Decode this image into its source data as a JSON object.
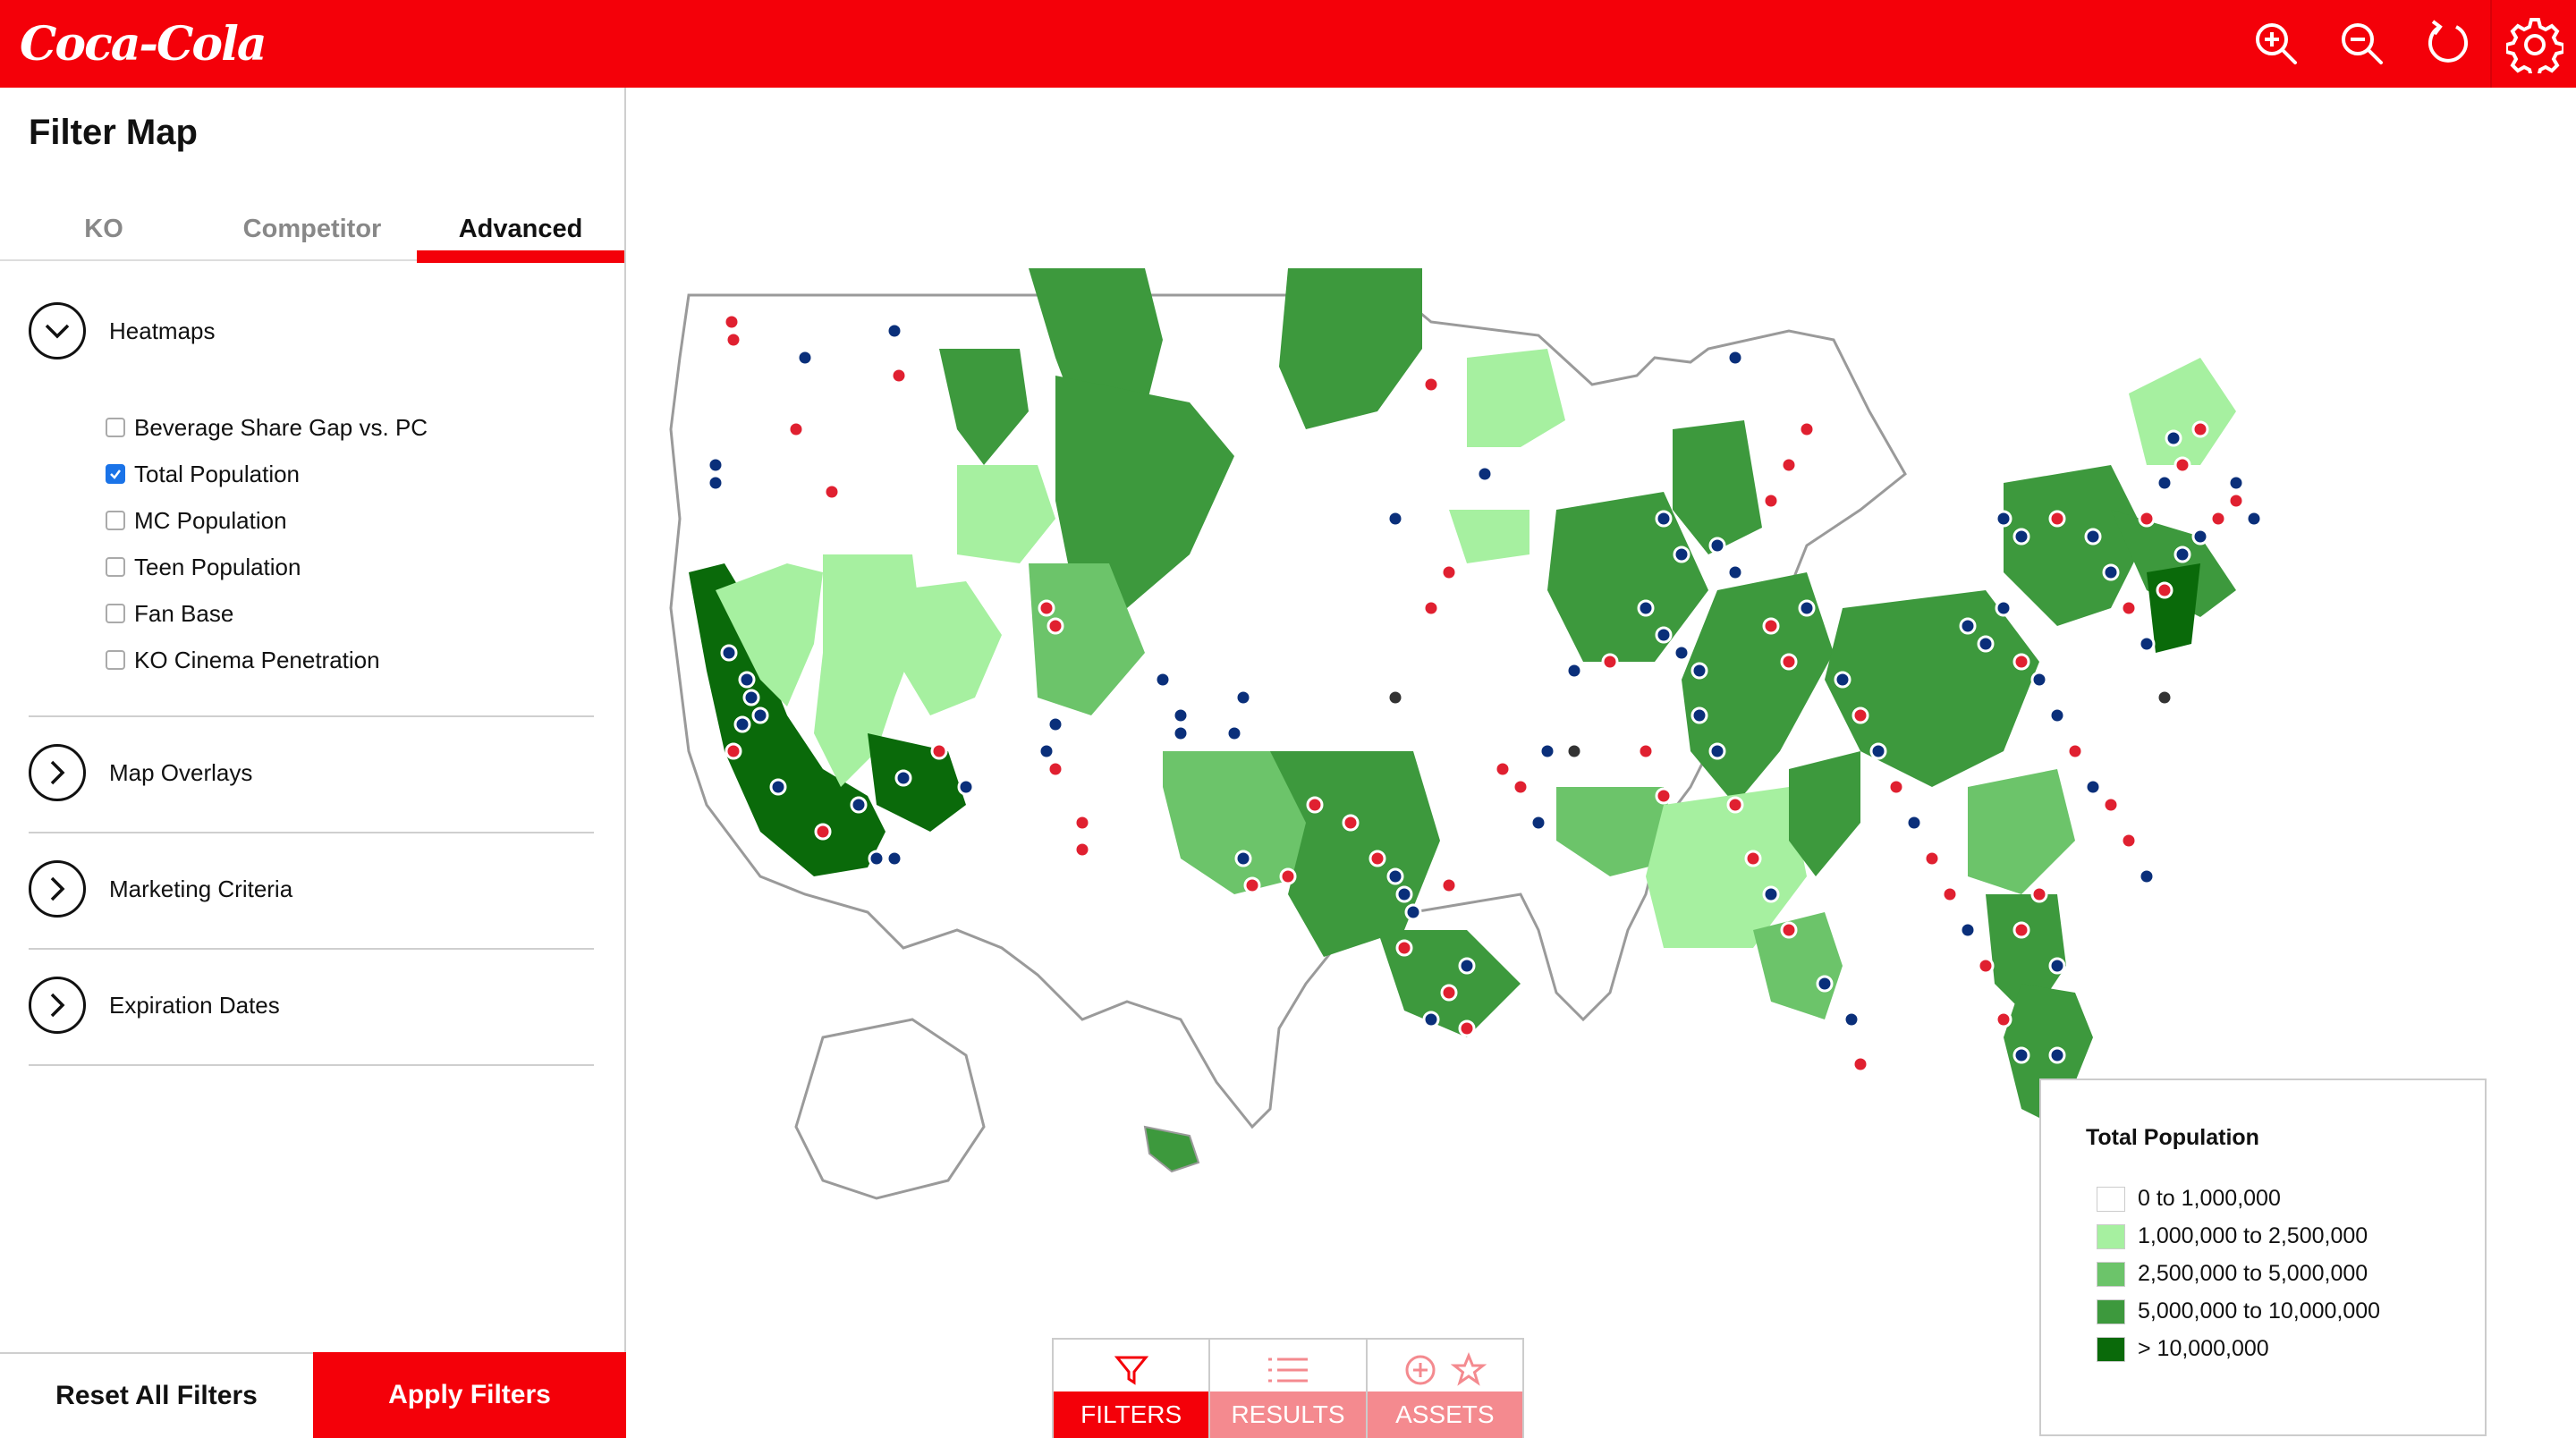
{
  "header": {
    "logo_text": "Coca-Cola",
    "brand_color": "#f40009",
    "icons": [
      "zoom-in-icon",
      "zoom-out-icon",
      "refresh-icon",
      "gear-icon"
    ]
  },
  "sidebar": {
    "title": "Filter Map",
    "tabs": [
      {
        "label": "KO",
        "active": false
      },
      {
        "label": "Competitor",
        "active": false
      },
      {
        "label": "Advanced",
        "active": true
      }
    ],
    "heatmaps": {
      "label": "Heatmaps",
      "expanded": true,
      "options": [
        {
          "label": "Beverage Share Gap vs. PC",
          "checked": false
        },
        {
          "label": "Total Population",
          "checked": true
        },
        {
          "label": "MC Population",
          "checked": false
        },
        {
          "label": "Teen Population",
          "checked": false
        },
        {
          "label": "Fan Base",
          "checked": false
        },
        {
          "label": "KO Cinema Penetration",
          "checked": false
        }
      ]
    },
    "sections": [
      {
        "label": "Map Overlays",
        "expanded": false
      },
      {
        "label": "Marketing Criteria",
        "expanded": false
      },
      {
        "label": "Expiration Dates",
        "expanded": false
      }
    ],
    "reset_label": "Reset All Filters",
    "apply_label": "Apply Filters"
  },
  "legend": {
    "title": "Total Population",
    "items": [
      {
        "label": "0 to 1,000,000",
        "color": "#ffffff"
      },
      {
        "label": "1,000,000 to 2,500,000",
        "color": "#a6f0a0"
      },
      {
        "label": "2,500,000 to 5,000,000",
        "color": "#6cc46a"
      },
      {
        "label": "5,000,000 to 10,000,000",
        "color": "#3d993d"
      },
      {
        "label": "> 10,000,000",
        "color": "#0a6a0a"
      }
    ]
  },
  "bottom_tabs": [
    {
      "label": "FILTERS",
      "icon": "filter-icon",
      "active": true
    },
    {
      "label": "RESULTS",
      "icon": "list-icon",
      "active": false
    },
    {
      "label": "ASSETS",
      "icon": "add-star-icon",
      "active": false
    }
  ],
  "marker_colors": {
    "ko": "#e02030",
    "competitor": "#0a2f7a",
    "other": "#333333"
  }
}
